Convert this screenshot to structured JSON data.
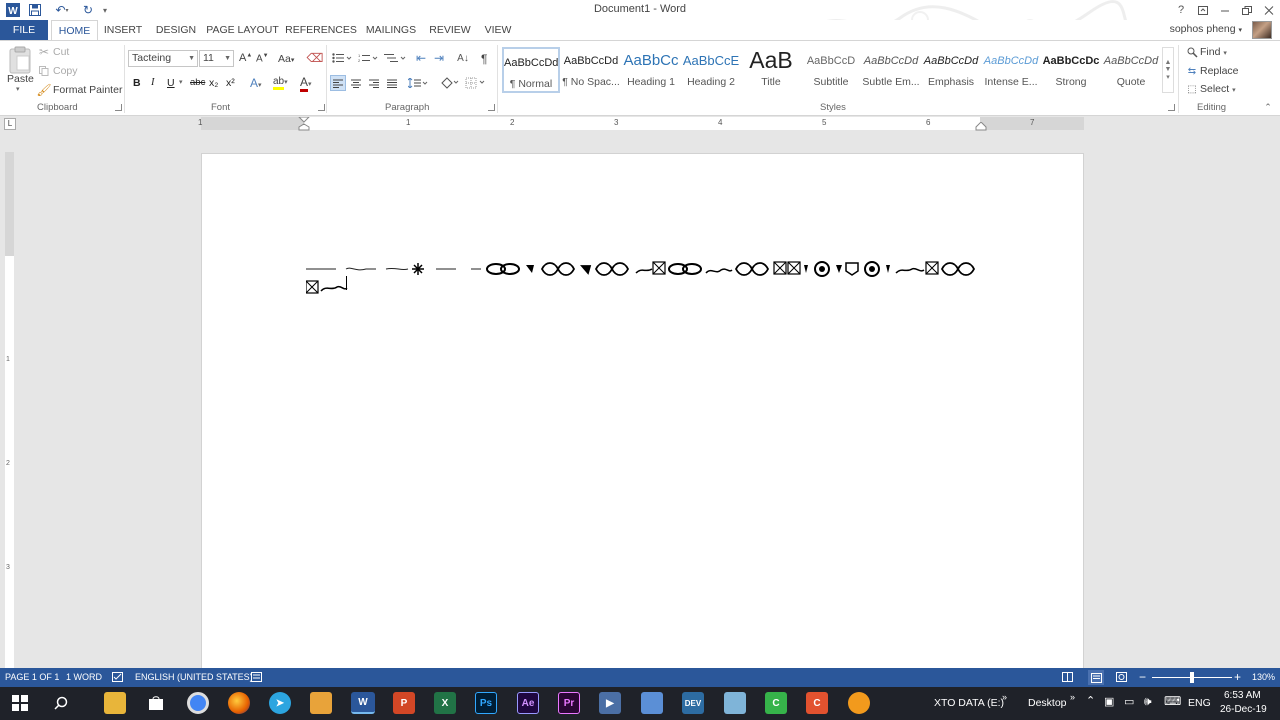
{
  "window": {
    "title": "Document1 - Word",
    "user": "sophos pheng",
    "help": "?"
  },
  "tabs": [
    "FILE",
    "HOME",
    "INSERT",
    "DESIGN",
    "PAGE LAYOUT",
    "REFERENCES",
    "MAILINGS",
    "REVIEW",
    "VIEW"
  ],
  "active_tab": "HOME",
  "clipboard": {
    "paste": "Paste",
    "cut": "Cut",
    "copy": "Copy",
    "format_painter": "Format Painter",
    "label": "Clipboard"
  },
  "font": {
    "name": "Tacteing",
    "size": "11",
    "label": "Font",
    "bold": "B",
    "italic": "I",
    "underline": "U",
    "strike": "abc",
    "subscript": "x₂",
    "superscript": "x²",
    "case": "Aa",
    "grow": "A",
    "shrink": "A",
    "text_effects": "A",
    "highlight": "ab",
    "font_color": "A"
  },
  "paragraph": {
    "label": "Paragraph",
    "pilcrow": "¶"
  },
  "styles": {
    "label": "Styles",
    "items": [
      {
        "sample": "AaBbCcDd",
        "name": "¶ Normal"
      },
      {
        "sample": "AaBbCcDd",
        "name": "¶ No Spac..."
      },
      {
        "sample": "AaBbCc",
        "name": "Heading 1"
      },
      {
        "sample": "AaBbCcE",
        "name": "Heading 2"
      },
      {
        "sample": "AaB",
        "name": "Title"
      },
      {
        "sample": "AaBbCcD",
        "name": "Subtitle"
      },
      {
        "sample": "AaBbCcDd",
        "name": "Subtle Em..."
      },
      {
        "sample": "AaBbCcDd",
        "name": "Emphasis"
      },
      {
        "sample": "AaBbCcDd",
        "name": "Intense E..."
      },
      {
        "sample": "AaBbCcDc",
        "name": "Strong"
      },
      {
        "sample": "AaBbCcDd",
        "name": "Quote"
      }
    ]
  },
  "editing": {
    "label": "Editing",
    "find": "Find",
    "replace": "Replace",
    "select": "Select"
  },
  "ruler": {
    "tab_selector": "L",
    "numbers": [
      "1",
      "1",
      "2",
      "3",
      "4",
      "5",
      "6",
      "7"
    ],
    "vertical_numbers": [
      "1",
      "2",
      "3"
    ]
  },
  "statusbar": {
    "page": "PAGE 1 OF 1",
    "words": "1 WORD",
    "language": "ENGLISH (UNITED STATES)",
    "zoom": "130%"
  },
  "taskbar": {
    "drive": "XTO DATA (E:)",
    "desktop": "Desktop",
    "language": "ENG",
    "time": "6:53 AM",
    "date": "26-Dec-19",
    "apps": [
      "file-explorer",
      "store",
      "chrome",
      "firefox",
      "telegram",
      "vlc",
      "word",
      "powerpoint",
      "excel",
      "photoshop",
      "after-effects",
      "premiere",
      "media",
      "box",
      "devtool",
      "edit",
      "camtasia",
      "camtasia-red",
      "fl-studio"
    ]
  },
  "colors": {
    "word_blue": "#2b579a",
    "taskbar": "#1f2229",
    "font_color_bar": "#c00000",
    "highlight_bar": "#ffff00"
  }
}
